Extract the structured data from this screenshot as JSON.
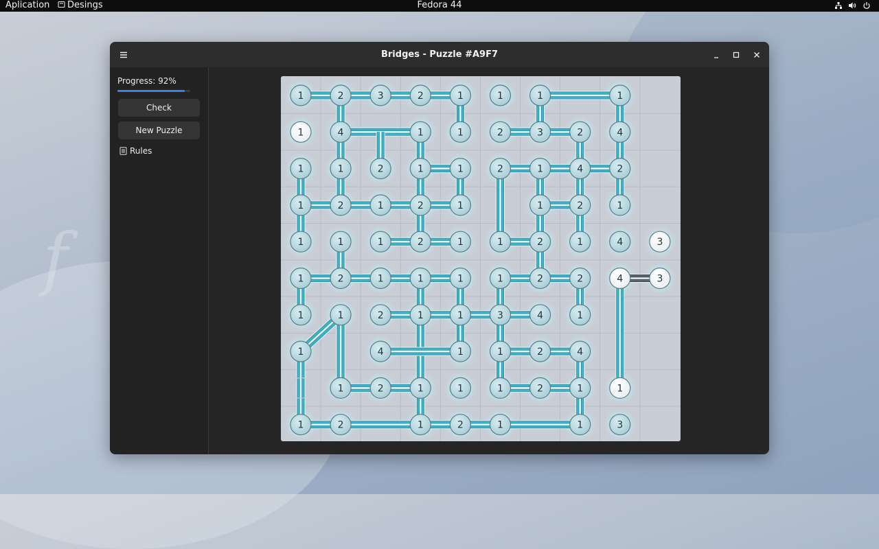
{
  "topbar": {
    "app_menu": "Aplication",
    "places_menu": "Desings",
    "clock": "Fedora 44",
    "icons": [
      "network-icon",
      "volume-icon",
      "power-icon"
    ]
  },
  "window": {
    "title": "Bridges - Puzzle #A9F7",
    "controls": [
      "menu-icon",
      "minimize-icon",
      "maximize-icon",
      "close-icon"
    ]
  },
  "sidebar": {
    "progress_label": "Progress: 92%",
    "progress_value": 0.92,
    "check_label": "Check",
    "new_puzzle_label": "New Puzzle",
    "rules_label": "Rules"
  },
  "colors": {
    "bridge": "#3fb3c7",
    "board": "#c9ced6",
    "node_fill": "#a8ccd6",
    "node_selected": "#e9eef3",
    "progress_accent": "#3584e4"
  },
  "board": {
    "cols": 10,
    "rows": 10,
    "islands": [
      {
        "c": 0,
        "r": 0,
        "n": "1"
      },
      {
        "c": 1,
        "r": 0,
        "n": "2"
      },
      {
        "c": 2,
        "r": 0,
        "n": "3"
      },
      {
        "c": 3,
        "r": 0,
        "n": "2"
      },
      {
        "c": 4,
        "r": 0,
        "n": "1"
      },
      {
        "c": 5,
        "r": 0,
        "n": "1"
      },
      {
        "c": 6,
        "r": 0,
        "n": "1"
      },
      {
        "c": 8,
        "r": 0,
        "n": "1"
      },
      {
        "c": 0,
        "r": 1,
        "n": "1",
        "state": "white"
      },
      {
        "c": 1,
        "r": 1,
        "n": "4"
      },
      {
        "c": 3,
        "r": 1,
        "n": "1"
      },
      {
        "c": 4,
        "r": 1,
        "n": "1"
      },
      {
        "c": 5,
        "r": 1,
        "n": "2"
      },
      {
        "c": 6,
        "r": 1,
        "n": "3"
      },
      {
        "c": 7,
        "r": 1,
        "n": "2"
      },
      {
        "c": 8,
        "r": 1,
        "n": "4"
      },
      {
        "c": 0,
        "r": 2,
        "n": "1"
      },
      {
        "c": 1,
        "r": 2,
        "n": "1"
      },
      {
        "c": 2,
        "r": 2,
        "n": "2"
      },
      {
        "c": 3,
        "r": 2,
        "n": "1"
      },
      {
        "c": 4,
        "r": 2,
        "n": "1"
      },
      {
        "c": 5,
        "r": 2,
        "n": "2"
      },
      {
        "c": 6,
        "r": 2,
        "n": "1"
      },
      {
        "c": 7,
        "r": 2,
        "n": "4"
      },
      {
        "c": 8,
        "r": 2,
        "n": "2"
      },
      {
        "c": 0,
        "r": 3,
        "n": "1"
      },
      {
        "c": 1,
        "r": 3,
        "n": "2"
      },
      {
        "c": 2,
        "r": 3,
        "n": "1"
      },
      {
        "c": 3,
        "r": 3,
        "n": "2"
      },
      {
        "c": 4,
        "r": 3,
        "n": "1"
      },
      {
        "c": 6,
        "r": 3,
        "n": "1"
      },
      {
        "c": 7,
        "r": 3,
        "n": "2"
      },
      {
        "c": 8,
        "r": 3,
        "n": "1"
      },
      {
        "c": 0,
        "r": 4,
        "n": "1"
      },
      {
        "c": 1,
        "r": 4,
        "n": "1"
      },
      {
        "c": 2,
        "r": 4,
        "n": "1"
      },
      {
        "c": 3,
        "r": 4,
        "n": "2"
      },
      {
        "c": 4,
        "r": 4,
        "n": "1"
      },
      {
        "c": 5,
        "r": 4,
        "n": "1"
      },
      {
        "c": 6,
        "r": 4,
        "n": "2"
      },
      {
        "c": 7,
        "r": 4,
        "n": "1"
      },
      {
        "c": 8,
        "r": 4,
        "n": "4"
      },
      {
        "c": 9,
        "r": 4,
        "n": "3",
        "state": "white"
      },
      {
        "c": 0,
        "r": 5,
        "n": "1"
      },
      {
        "c": 1,
        "r": 5,
        "n": "2"
      },
      {
        "c": 2,
        "r": 5,
        "n": "1"
      },
      {
        "c": 3,
        "r": 5,
        "n": "1"
      },
      {
        "c": 4,
        "r": 5,
        "n": "1"
      },
      {
        "c": 5,
        "r": 5,
        "n": "1"
      },
      {
        "c": 6,
        "r": 5,
        "n": "2"
      },
      {
        "c": 7,
        "r": 5,
        "n": "2"
      },
      {
        "c": 8,
        "r": 5,
        "n": "4",
        "state": "white"
      },
      {
        "c": 9,
        "r": 5,
        "n": "3",
        "state": "white"
      },
      {
        "c": 0,
        "r": 6,
        "n": "1"
      },
      {
        "c": 1,
        "r": 6,
        "n": "1"
      },
      {
        "c": 2,
        "r": 6,
        "n": "2"
      },
      {
        "c": 3,
        "r": 6,
        "n": "1"
      },
      {
        "c": 4,
        "r": 6,
        "n": "1"
      },
      {
        "c": 5,
        "r": 6,
        "n": "3"
      },
      {
        "c": 6,
        "r": 6,
        "n": "4"
      },
      {
        "c": 7,
        "r": 6,
        "n": "1"
      },
      {
        "c": 0,
        "r": 7,
        "n": "1"
      },
      {
        "c": 2,
        "r": 7,
        "n": "4"
      },
      {
        "c": 4,
        "r": 7,
        "n": "1"
      },
      {
        "c": 5,
        "r": 7,
        "n": "1"
      },
      {
        "c": 6,
        "r": 7,
        "n": "2"
      },
      {
        "c": 7,
        "r": 7,
        "n": "4"
      },
      {
        "c": 0,
        "r": 8,
        "n": "",
        "state": "ghost"
      },
      {
        "c": 1,
        "r": 8,
        "n": "1"
      },
      {
        "c": 2,
        "r": 8,
        "n": "2"
      },
      {
        "c": 3,
        "r": 8,
        "n": "1"
      },
      {
        "c": 4,
        "r": 8,
        "n": "1"
      },
      {
        "c": 5,
        "r": 8,
        "n": "1"
      },
      {
        "c": 6,
        "r": 8,
        "n": "2"
      },
      {
        "c": 7,
        "r": 8,
        "n": "1"
      },
      {
        "c": 8,
        "r": 8,
        "n": "1",
        "state": "white"
      },
      {
        "c": 0,
        "r": 9,
        "n": "1"
      },
      {
        "c": 1,
        "r": 9,
        "n": "2"
      },
      {
        "c": 3,
        "r": 9,
        "n": "1"
      },
      {
        "c": 4,
        "r": 9,
        "n": "2"
      },
      {
        "c": 5,
        "r": 9,
        "n": "1"
      },
      {
        "c": 7,
        "r": 9,
        "n": "1"
      },
      {
        "c": 8,
        "r": 9,
        "n": "3"
      }
    ],
    "bridges": [
      {
        "a": [
          0,
          0
        ],
        "b": [
          1,
          0
        ],
        "n": 2
      },
      {
        "a": [
          1,
          0
        ],
        "b": [
          2,
          0
        ],
        "n": 2
      },
      {
        "a": [
          2,
          0
        ],
        "b": [
          3,
          0
        ],
        "n": 2
      },
      {
        "a": [
          3,
          0
        ],
        "b": [
          4,
          0
        ],
        "n": 2
      },
      {
        "a": [
          6,
          0
        ],
        "b": [
          8,
          0
        ],
        "n": 2
      },
      {
        "a": [
          1,
          0
        ],
        "b": [
          1,
          1
        ],
        "n": 2
      },
      {
        "a": [
          4,
          0
        ],
        "b": [
          4,
          1
        ],
        "n": 2
      },
      {
        "a": [
          6,
          0
        ],
        "b": [
          6,
          1
        ],
        "n": 2
      },
      {
        "a": [
          8,
          0
        ],
        "b": [
          8,
          1
        ],
        "n": 2
      },
      {
        "a": [
          1,
          1
        ],
        "b": [
          3,
          1
        ],
        "n": 2
      },
      {
        "a": [
          5,
          1
        ],
        "b": [
          6,
          1
        ],
        "n": 2
      },
      {
        "a": [
          6,
          1
        ],
        "b": [
          7,
          1
        ],
        "n": 2
      },
      {
        "a": [
          1,
          1
        ],
        "b": [
          1,
          2
        ],
        "n": 2
      },
      {
        "a": [
          2,
          1
        ],
        "b": [
          2,
          2
        ],
        "n": 2
      },
      {
        "a": [
          3,
          1
        ],
        "b": [
          3,
          2
        ],
        "n": 2
      },
      {
        "a": [
          7,
          1
        ],
        "b": [
          7,
          2
        ],
        "n": 2
      },
      {
        "a": [
          8,
          1
        ],
        "b": [
          8,
          2
        ],
        "n": 2
      },
      {
        "a": [
          3,
          2
        ],
        "b": [
          4,
          2
        ],
        "n": 2
      },
      {
        "a": [
          5,
          2
        ],
        "b": [
          6,
          2
        ],
        "n": 2
      },
      {
        "a": [
          6,
          2
        ],
        "b": [
          7,
          2
        ],
        "n": 2
      },
      {
        "a": [
          7,
          2
        ],
        "b": [
          8,
          2
        ],
        "n": 2
      },
      {
        "a": [
          0,
          2
        ],
        "b": [
          0,
          3
        ],
        "n": 2
      },
      {
        "a": [
          1,
          2
        ],
        "b": [
          1,
          3
        ],
        "n": 2
      },
      {
        "a": [
          3,
          2
        ],
        "b": [
          3,
          3
        ],
        "n": 2
      },
      {
        "a": [
          4,
          2
        ],
        "b": [
          4,
          3
        ],
        "n": 2
      },
      {
        "a": [
          5,
          2
        ],
        "b": [
          5,
          4
        ],
        "n": 2
      },
      {
        "a": [
          6,
          2
        ],
        "b": [
          6,
          3
        ],
        "n": 2
      },
      {
        "a": [
          7,
          2
        ],
        "b": [
          7,
          3
        ],
        "n": 2
      },
      {
        "a": [
          8,
          2
        ],
        "b": [
          8,
          3
        ],
        "n": 2
      },
      {
        "a": [
          0,
          3
        ],
        "b": [
          1,
          3
        ],
        "n": 2
      },
      {
        "a": [
          1,
          3
        ],
        "b": [
          2,
          3
        ],
        "n": 2
      },
      {
        "a": [
          2,
          3
        ],
        "b": [
          3,
          3
        ],
        "n": 2
      },
      {
        "a": [
          3,
          3
        ],
        "b": [
          4,
          3
        ],
        "n": 2
      },
      {
        "a": [
          6,
          3
        ],
        "b": [
          7,
          3
        ],
        "n": 2
      },
      {
        "a": [
          0,
          3
        ],
        "b": [
          0,
          4
        ],
        "n": 2
      },
      {
        "a": [
          3,
          3
        ],
        "b": [
          3,
          4
        ],
        "n": 2
      },
      {
        "a": [
          6,
          3
        ],
        "b": [
          6,
          4
        ],
        "n": 2
      },
      {
        "a": [
          7,
          3
        ],
        "b": [
          7,
          4
        ],
        "n": 2
      },
      {
        "a": [
          2,
          4
        ],
        "b": [
          3,
          4
        ],
        "n": 2
      },
      {
        "a": [
          3,
          4
        ],
        "b": [
          4,
          4
        ],
        "n": 2
      },
      {
        "a": [
          5,
          4
        ],
        "b": [
          6,
          4
        ],
        "n": 2
      },
      {
        "a": [
          1,
          4
        ],
        "b": [
          1,
          5
        ],
        "n": 2
      },
      {
        "a": [
          6,
          4
        ],
        "b": [
          6,
          5
        ],
        "n": 2
      },
      {
        "a": [
          0,
          5
        ],
        "b": [
          1,
          5
        ],
        "n": 2
      },
      {
        "a": [
          1,
          5
        ],
        "b": [
          2,
          5
        ],
        "n": 2
      },
      {
        "a": [
          2,
          5
        ],
        "b": [
          3,
          5
        ],
        "n": 2
      },
      {
        "a": [
          3,
          5
        ],
        "b": [
          4,
          5
        ],
        "n": 2
      },
      {
        "a": [
          5,
          5
        ],
        "b": [
          6,
          5
        ],
        "n": 2
      },
      {
        "a": [
          6,
          5
        ],
        "b": [
          7,
          5
        ],
        "n": 2
      },
      {
        "a": [
          8,
          5
        ],
        "b": [
          9,
          5
        ],
        "n": 2,
        "style": "gray"
      },
      {
        "a": [
          0,
          5
        ],
        "b": [
          0,
          6
        ],
        "n": 2
      },
      {
        "a": [
          3,
          5
        ],
        "b": [
          3,
          9
        ],
        "n": 2
      },
      {
        "a": [
          4,
          5
        ],
        "b": [
          4,
          6
        ],
        "n": 2
      },
      {
        "a": [
          5,
          5
        ],
        "b": [
          5,
          6
        ],
        "n": 2
      },
      {
        "a": [
          7,
          5
        ],
        "b": [
          7,
          6
        ],
        "n": 2
      },
      {
        "a": [
          8,
          5
        ],
        "b": [
          8,
          8
        ],
        "n": 2
      },
      {
        "a": [
          2,
          6
        ],
        "b": [
          3,
          6
        ],
        "n": 2
      },
      {
        "a": [
          3,
          6
        ],
        "b": [
          4,
          6
        ],
        "n": 2
      },
      {
        "a": [
          4,
          6
        ],
        "b": [
          5,
          6
        ],
        "n": 2
      },
      {
        "a": [
          5,
          6
        ],
        "b": [
          6,
          6
        ],
        "n": 2
      },
      {
        "a": [
          1,
          6
        ],
        "b": [
          0,
          7
        ],
        "n": 2
      },
      {
        "a": [
          1,
          6
        ],
        "b": [
          1,
          8
        ],
        "n": 2
      },
      {
        "a": [
          4,
          6
        ],
        "b": [
          4,
          7
        ],
        "n": 2
      },
      {
        "a": [
          5,
          6
        ],
        "b": [
          5,
          7
        ],
        "n": 2
      },
      {
        "a": [
          2,
          7
        ],
        "b": [
          4,
          7
        ],
        "n": 2
      },
      {
        "a": [
          5,
          7
        ],
        "b": [
          6,
          7
        ],
        "n": 2
      },
      {
        "a": [
          6,
          7
        ],
        "b": [
          7,
          7
        ],
        "n": 2
      },
      {
        "a": [
          0,
          7
        ],
        "b": [
          0,
          9
        ],
        "n": 2
      },
      {
        "a": [
          5,
          7
        ],
        "b": [
          5,
          8
        ],
        "n": 2
      },
      {
        "a": [
          7,
          7
        ],
        "b": [
          7,
          8
        ],
        "n": 2
      },
      {
        "a": [
          1,
          8
        ],
        "b": [
          2,
          8
        ],
        "n": 2
      },
      {
        "a": [
          2,
          8
        ],
        "b": [
          3,
          8
        ],
        "n": 2
      },
      {
        "a": [
          5,
          8
        ],
        "b": [
          6,
          8
        ],
        "n": 2
      },
      {
        "a": [
          6,
          8
        ],
        "b": [
          7,
          8
        ],
        "n": 2
      },
      {
        "a": [
          7,
          8
        ],
        "b": [
          7,
          9
        ],
        "n": 2
      },
      {
        "a": [
          0,
          9
        ],
        "b": [
          1,
          9
        ],
        "n": 2
      },
      {
        "a": [
          1,
          9
        ],
        "b": [
          3,
          9
        ],
        "n": 2
      },
      {
        "a": [
          3,
          9
        ],
        "b": [
          4,
          9
        ],
        "n": 2
      },
      {
        "a": [
          4,
          9
        ],
        "b": [
          5,
          9
        ],
        "n": 2
      },
      {
        "a": [
          5,
          9
        ],
        "b": [
          7,
          9
        ],
        "n": 2
      }
    ]
  }
}
